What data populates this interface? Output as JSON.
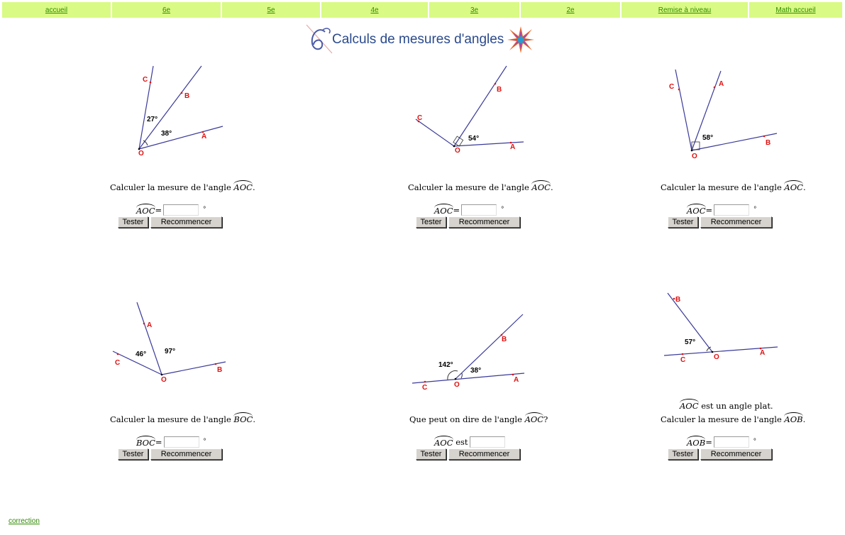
{
  "nav": {
    "items": [
      {
        "label": "accueil"
      },
      {
        "label": "6e"
      },
      {
        "label": "5e"
      },
      {
        "label": "4e"
      },
      {
        "label": "3e"
      },
      {
        "label": "2e"
      },
      {
        "label": "Remise à niveau"
      },
      {
        "label": "Math accueil"
      }
    ]
  },
  "page": {
    "title": "Calculs de mesures d'angles"
  },
  "buttons": {
    "test": "Tester",
    "restart": "Recommencer"
  },
  "exercises": [
    {
      "question_prefix": "Calculer la mesure de l'angle",
      "question_angle": "AOC",
      "question_suffix": ".",
      "answer_angle": "AOC",
      "answer_sep": "=",
      "answer_unit": "°",
      "fig": {
        "p1": "C",
        "p2": "B",
        "p3": "A",
        "o": "O",
        "v1": "27°",
        "v2": "38°"
      }
    },
    {
      "question_prefix": "Calculer la mesure de l'angle",
      "question_angle": "AOC",
      "question_suffix": ".",
      "answer_angle": "AOC",
      "answer_sep": "=",
      "answer_unit": "°",
      "fig": {
        "p1": "C",
        "p2": "B",
        "p3": "A",
        "o": "O",
        "v1": "54°"
      }
    },
    {
      "question_prefix": "Calculer la mesure de l'angle",
      "question_angle": "AOC",
      "question_suffix": ".",
      "answer_angle": "AOC",
      "answer_sep": "=",
      "answer_unit": "°",
      "fig": {
        "p1": "C",
        "p2": "A",
        "p3": "B",
        "o": "O",
        "v1": "58°"
      }
    },
    {
      "question_prefix": "Calculer la mesure de l'angle",
      "question_angle": "BOC",
      "question_suffix": ".",
      "answer_angle": "BOC",
      "answer_sep": "=",
      "answer_unit": "°",
      "fig": {
        "p1": "A",
        "p2": "C",
        "p3": "B",
        "o": "O",
        "v1": "46°",
        "v2": "97°"
      }
    },
    {
      "question_prefix": "Que peut on dire de l'angle",
      "question_angle": "AOC",
      "question_suffix": "?",
      "answer_angle": "AOC",
      "answer_sep": "est",
      "answer_unit": "",
      "fig": {
        "p1": "B",
        "p2": "C",
        "p3": "A",
        "o": "O",
        "v1": "142°",
        "v2": "38°"
      }
    },
    {
      "note_angle": "AOC",
      "note_text": "est un angle plat.",
      "question_prefix": "Calculer la mesure de l'angle",
      "question_angle": "AOB",
      "question_suffix": ".",
      "answer_angle": "AOB",
      "answer_sep": "=",
      "answer_unit": "°",
      "fig": {
        "p1": "B",
        "p2": "C",
        "p3": "A",
        "o": "O",
        "v1": "57°"
      }
    }
  ],
  "footer": {
    "link": "correction"
  },
  "colors": {
    "nav_bg": "#d9fa84",
    "link": "#2f8a00",
    "point_label": "#e01010",
    "line": "#3a3a9a",
    "title": "#2a4a8c"
  }
}
